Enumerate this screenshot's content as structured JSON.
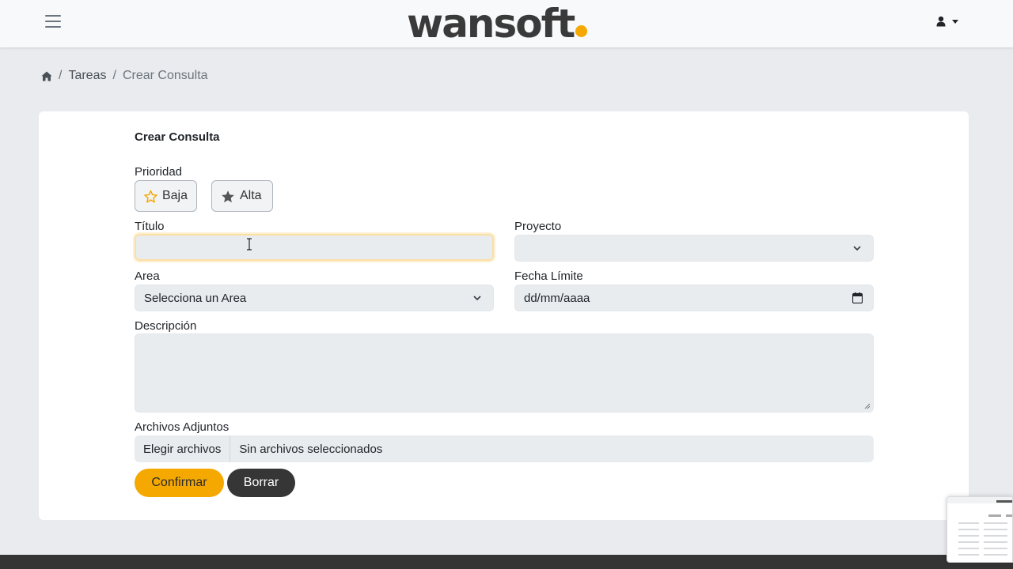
{
  "header": {
    "logo_text": "wansoft",
    "menu_icon": "hamburger-icon",
    "user_icon": "user-icon"
  },
  "breadcrumb": {
    "home_icon": "home-icon",
    "items": [
      "Tareas",
      "Crear Consulta"
    ],
    "separator": "/"
  },
  "form": {
    "title": "Crear Consulta",
    "priority": {
      "label": "Prioridad",
      "options": [
        {
          "label": "Baja",
          "icon": "star-outline-icon"
        },
        {
          "label": "Alta",
          "icon": "star-filled-icon"
        }
      ]
    },
    "titulo": {
      "label": "Título",
      "value": ""
    },
    "proyecto": {
      "label": "Proyecto",
      "value": ""
    },
    "area": {
      "label": "Area",
      "value": "Selecciona un Area"
    },
    "fecha": {
      "label": "Fecha Límite",
      "value": "dd/mm/aaaa"
    },
    "descripcion": {
      "label": "Descripción",
      "value": ""
    },
    "archivos": {
      "label": "Archivos Adjuntos",
      "button": "Elegir archivos",
      "status": "Sin archivos seleccionados"
    },
    "confirm_label": "Confirmar",
    "clear_label": "Borrar"
  },
  "colors": {
    "accent": "#f5a800",
    "dark_button": "#363636",
    "background": "#e9ebee"
  }
}
